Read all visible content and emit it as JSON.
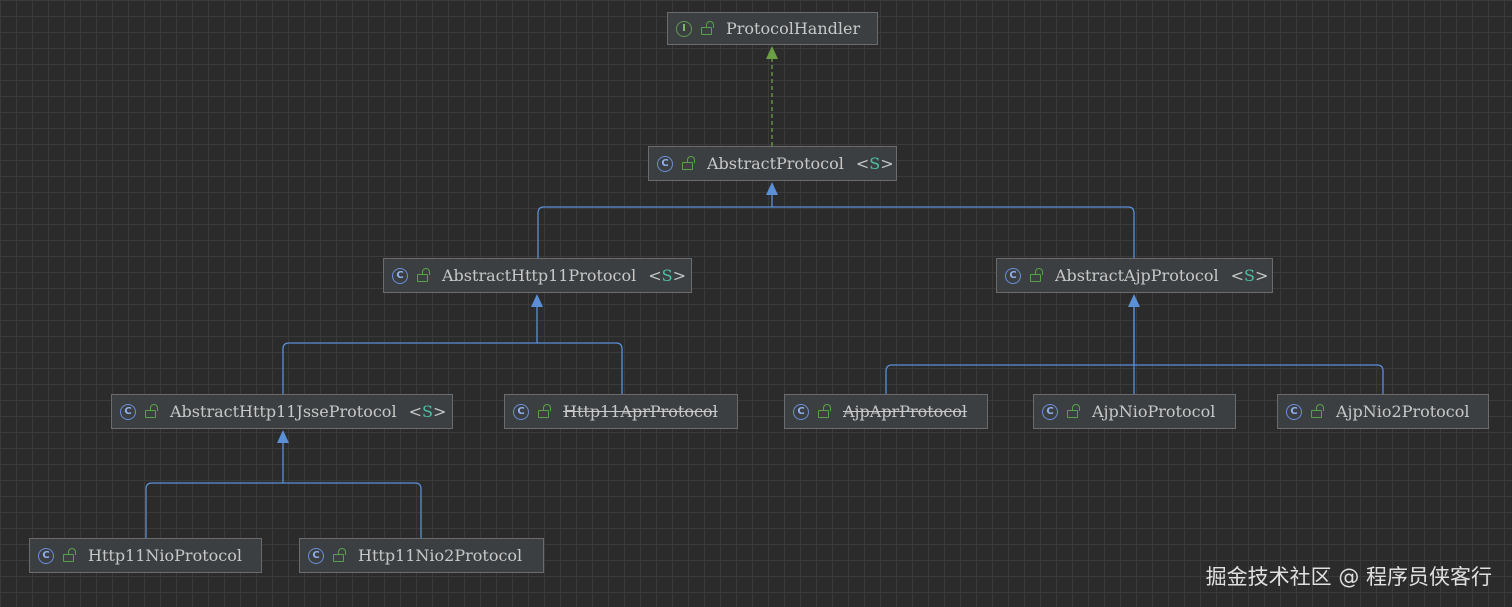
{
  "diagram": {
    "nodes": [
      {
        "id": "protocol-handler",
        "name": "ProtocolHandler",
        "kind": "I",
        "generic": ""
      },
      {
        "id": "abstract-protocol",
        "name": "AbstractProtocol",
        "kind": "C",
        "generic": "S"
      },
      {
        "id": "abstract-http11-protocol",
        "name": "AbstractHttp11Protocol",
        "kind": "C",
        "generic": "S"
      },
      {
        "id": "abstract-ajp-protocol",
        "name": "AbstractAjpProtocol",
        "kind": "C",
        "generic": "S"
      },
      {
        "id": "abstract-http11-jsse-protocol",
        "name": "AbstractHttp11JsseProtocol",
        "kind": "C",
        "generic": "S"
      },
      {
        "id": "http11-apr-protocol",
        "name": "Http11AprProtocol",
        "kind": "C",
        "generic": "",
        "deprecated": true
      },
      {
        "id": "ajp-apr-protocol",
        "name": "AjpAprProtocol",
        "kind": "C",
        "generic": "",
        "deprecated": true
      },
      {
        "id": "ajp-nio-protocol",
        "name": "AjpNioProtocol",
        "kind": "C",
        "generic": ""
      },
      {
        "id": "ajp-nio2-protocol",
        "name": "AjpNio2Protocol",
        "kind": "C",
        "generic": ""
      },
      {
        "id": "http11-nio-protocol",
        "name": "Http11NioProtocol",
        "kind": "C",
        "generic": ""
      },
      {
        "id": "http11-nio2-protocol",
        "name": "Http11Nio2Protocol",
        "kind": "C",
        "generic": ""
      }
    ],
    "edges": [
      {
        "from": "abstract-protocol",
        "to": "protocol-handler",
        "type": "implements"
      },
      {
        "from": "abstract-http11-protocol",
        "to": "abstract-protocol",
        "type": "extends"
      },
      {
        "from": "abstract-ajp-protocol",
        "to": "abstract-protocol",
        "type": "extends"
      },
      {
        "from": "abstract-http11-jsse-protocol",
        "to": "abstract-http11-protocol",
        "type": "extends"
      },
      {
        "from": "http11-apr-protocol",
        "to": "abstract-http11-protocol",
        "type": "extends"
      },
      {
        "from": "ajp-apr-protocol",
        "to": "abstract-ajp-protocol",
        "type": "extends"
      },
      {
        "from": "ajp-nio-protocol",
        "to": "abstract-ajp-protocol",
        "type": "extends"
      },
      {
        "from": "ajp-nio2-protocol",
        "to": "abstract-ajp-protocol",
        "type": "extends"
      },
      {
        "from": "http11-nio-protocol",
        "to": "abstract-http11-jsse-protocol",
        "type": "extends"
      },
      {
        "from": "http11-nio2-protocol",
        "to": "abstract-http11-jsse-protocol",
        "type": "extends"
      }
    ],
    "colors": {
      "background": "#2b2b2b",
      "extends_edge": "#5b8fd6",
      "implements_edge": "#6a9f45",
      "class_icon": "#6a8fd8",
      "interface_icon": "#5f9a4f",
      "type_param": "#4fbfa6"
    },
    "icons": {
      "class": "class-c-icon",
      "interface": "interface-i-icon",
      "visibility": "lock-open-icon"
    }
  },
  "watermark": "掘金技术社区 @ 程序员侠客行"
}
